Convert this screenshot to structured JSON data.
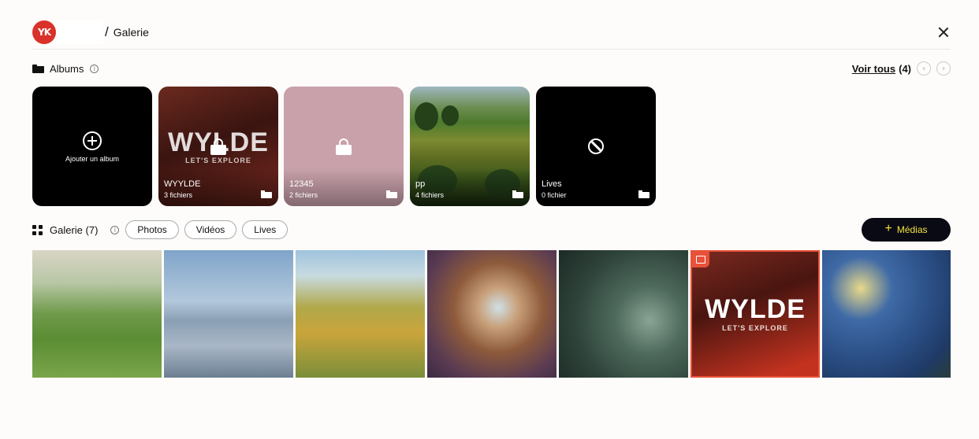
{
  "header": {
    "logo_text": "YK",
    "breadcrumb_separator": "/",
    "breadcrumb_current": "Galerie"
  },
  "albums": {
    "title": "Albums",
    "see_all_label": "Voir tous",
    "see_all_count": "(4)",
    "add_label": "Ajouter un album",
    "items": [
      {
        "name": "WYYLDE",
        "files": "3 fichiers",
        "cover_text": "WYLDE",
        "cover_tagline": "LET'S EXPLORE",
        "locked": true
      },
      {
        "name": "12345",
        "files": "2 fichiers",
        "locked": true,
        "cover_color": "#c9a1ab"
      },
      {
        "name": "pp",
        "files": "4 fichiers",
        "locked": false
      },
      {
        "name": "Lives",
        "files": "0 fichier",
        "locked": false,
        "icon": "ban-icon"
      }
    ]
  },
  "gallery": {
    "title": "Galerie (7)",
    "filters": [
      "Photos",
      "Vidéos",
      "Lives"
    ],
    "add_media_label": "Médias",
    "thumbnails": [
      {
        "subject": "landscape-cypress"
      },
      {
        "subject": "mount-fuji-torii"
      },
      {
        "subject": "sunflowers"
      },
      {
        "subject": "sky-vortex"
      },
      {
        "subject": "ruined-arches"
      },
      {
        "subject": "wyylde-logo",
        "cover_text": "WYLDE",
        "cover_tagline": "LET'S EXPLORE",
        "selected": true
      },
      {
        "subject": "starry-night"
      }
    ]
  },
  "colors": {
    "accent_red": "#d8322a",
    "media_button_bg": "#0a0a14",
    "media_button_text": "#f3e33b",
    "selected_border": "#e8513a"
  }
}
